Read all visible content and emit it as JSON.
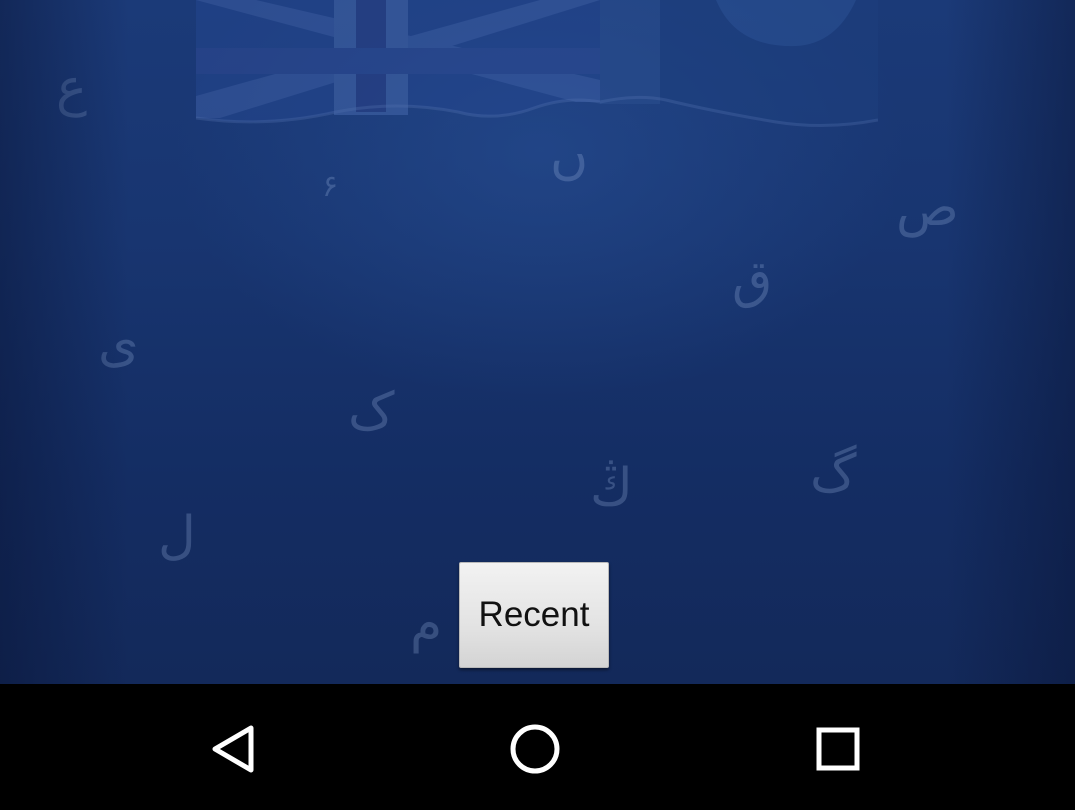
{
  "app": {
    "recent_button_label": "Recent",
    "background_letters": [
      "ع",
      "ں",
      "۶",
      "ص",
      "ق",
      "ی",
      "ک",
      "ڭ",
      "گ",
      "ل",
      "م"
    ],
    "accent_color": "#183570"
  },
  "nav_bar": {
    "back_icon": "back-triangle-icon",
    "home_icon": "home-circle-icon",
    "recents_icon": "recents-square-icon",
    "icon_color": "#ffffff",
    "background_color": "#000000"
  }
}
